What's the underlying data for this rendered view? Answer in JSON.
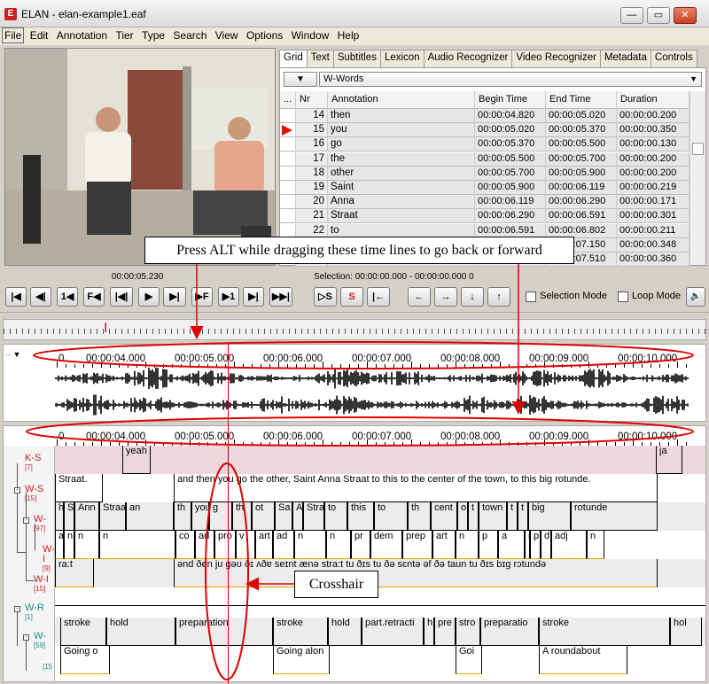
{
  "window": {
    "title": "ELAN - elan-example1.eaf",
    "icon": "elan-app-icon",
    "min": "—",
    "max": "▭",
    "close": "✕"
  },
  "menu": [
    "File",
    "Edit",
    "Annotation",
    "Tier",
    "Type",
    "Search",
    "View",
    "Options",
    "Window",
    "Help"
  ],
  "tabs": [
    "Grid",
    "Text",
    "Subtitles",
    "Lexicon",
    "Audio Recognizer",
    "Video Recognizer",
    "Metadata",
    "Controls"
  ],
  "grid": {
    "tier_selector": "W-Words",
    "dropdown_btn": "▼",
    "columns": [
      "...",
      "Nr",
      "Annotation",
      "Begin Time",
      "End Time",
      "Duration"
    ],
    "rows": [
      {
        "nr": "14",
        "ann": "then",
        "begin": "00:00:04.820",
        "end": "00:00:05.020",
        "dur": "00:00:00.200"
      },
      {
        "nr": "15",
        "ann": "you",
        "begin": "00:00:05.020",
        "end": "00:00:05.370",
        "dur": "00:00:00.350"
      },
      {
        "nr": "16",
        "ann": "go",
        "begin": "00:00:05.370",
        "end": "00:00:05.500",
        "dur": "00:00:00.130"
      },
      {
        "nr": "17",
        "ann": "the",
        "begin": "00:00:05.500",
        "end": "00:00:05.700",
        "dur": "00:00:00.200"
      },
      {
        "nr": "18",
        "ann": "other",
        "begin": "00:00:05.700",
        "end": "00:00:05.900",
        "dur": "00:00:00.200"
      },
      {
        "nr": "19",
        "ann": "Saint",
        "begin": "00:00:05.900",
        "end": "00:00:06.119",
        "dur": "00:00:00.219"
      },
      {
        "nr": "20",
        "ann": "Anna",
        "begin": "00:00:06.119",
        "end": "00:00:06.290",
        "dur": "00:00:00.171"
      },
      {
        "nr": "21",
        "ann": "Straat",
        "begin": "00:00:06.290",
        "end": "00:00:06.591",
        "dur": "00:00:00.301"
      },
      {
        "nr": "22",
        "ann": "to",
        "begin": "00:00:06.591",
        "end": "00:00:06.802",
        "dur": "00:00:00.211"
      },
      {
        "nr": "",
        "ann": "",
        "begin": "",
        "end": "00:00:07.150",
        "dur": "00:00:00.348"
      },
      {
        "nr": "",
        "ann": "",
        "begin": "",
        "end": "00:00:07.510",
        "dur": "00:00:00.360"
      }
    ],
    "current_row": 1
  },
  "callout_top": "Press ALT while dragging these time lines to go back or forward",
  "callout_crosshair": "Crosshair",
  "media_time": "00:00:05.230",
  "selection": "Selection: 00:00:00.000 - 00:00:00.000  0",
  "controls": [
    "|◀",
    "◀|",
    "1◀",
    "F◀",
    "|◀|",
    "▶",
    "▶|",
    "▶F",
    "▶1",
    "▶|",
    "▶▶|"
  ],
  "sel_controls": [
    "▷S",
    "S",
    "|←"
  ],
  "nav_controls": [
    "←",
    "→",
    "↓",
    "↑"
  ],
  "selection_mode": "Selection Mode",
  "loop_mode": "Loop Mode",
  "speaker_icon": "🔈",
  "ibeam_icon": "I",
  "wave_corner": "·· ▼",
  "ruler_labels": [
    "0",
    "00:00:04.000",
    "00:00:05.000",
    "00:00:06.000",
    "00:00:07.000",
    "00:00:08.000",
    "00:00:09.000",
    "00:00:10.000"
  ],
  "tiers": [
    {
      "name": "K-S",
      "count": "[7]",
      "color": "#d02020"
    },
    {
      "name": "W-S",
      "count": "[15]",
      "color": "#d02020"
    },
    {
      "name": "W-",
      "count": "[97]",
      "color": "#d02020"
    },
    {
      "name": "W-I",
      "count": "[9]",
      "color": "#d02020"
    },
    {
      "name": "W-I",
      "count": "[15]",
      "color": "#d02020"
    },
    {
      "name": "W-R",
      "count": "[1]",
      "color": "#109090"
    },
    {
      "name": "W-",
      "count": "[59]",
      "color": "#109090"
    },
    {
      "name": "",
      "count": "[15",
      "color": "#109090"
    }
  ],
  "annotations": {
    "ks": [
      {
        "t": "yeah"
      },
      {
        "t": "ja"
      }
    ],
    "ws": [
      {
        "t": "Straat."
      },
      {
        "t": "and then you go the other, Saint Anna Straat to this to the center of the town, to this big rotunde."
      }
    ],
    "ww": [
      "h",
      "S",
      "Ann",
      "Straa",
      "an",
      "th",
      "you",
      "g",
      "th",
      "ot",
      "Sa",
      "A",
      "Stra",
      "to",
      "this",
      "to",
      "th",
      "cent",
      "o",
      "t",
      "town",
      "t",
      "t",
      "big",
      "rotunde"
    ],
    "wpos": [
      "a",
      "n",
      "n",
      "n",
      "co",
      "ad",
      "pro",
      "v",
      "art",
      "ad",
      "n",
      "n",
      "pr",
      "dem",
      "prep",
      "art",
      "n",
      "p",
      "a",
      "n",
      "p",
      "d",
      "adj",
      "n"
    ],
    "wpos_extra": "[9",
    "wipa": [
      {
        "t": "ra:t"
      },
      {
        "t": "ənd ðen ju gəʊ ðɪ ʌðɐ seɪnt ænə stra:t tu ðɪs tu ðə sɛntə əf ðə taun tu ðɪs bɪg rɔtundə"
      }
    ],
    "gest": [
      "stroke",
      "hold",
      "preparation",
      "stroke",
      "hold",
      "part.retracti",
      "h",
      "pre",
      "stro",
      "preparatio",
      "stroke",
      "hol"
    ],
    "gesttxt": [
      "Going o",
      "Going alon",
      "Goi",
      "A roundabout"
    ]
  }
}
